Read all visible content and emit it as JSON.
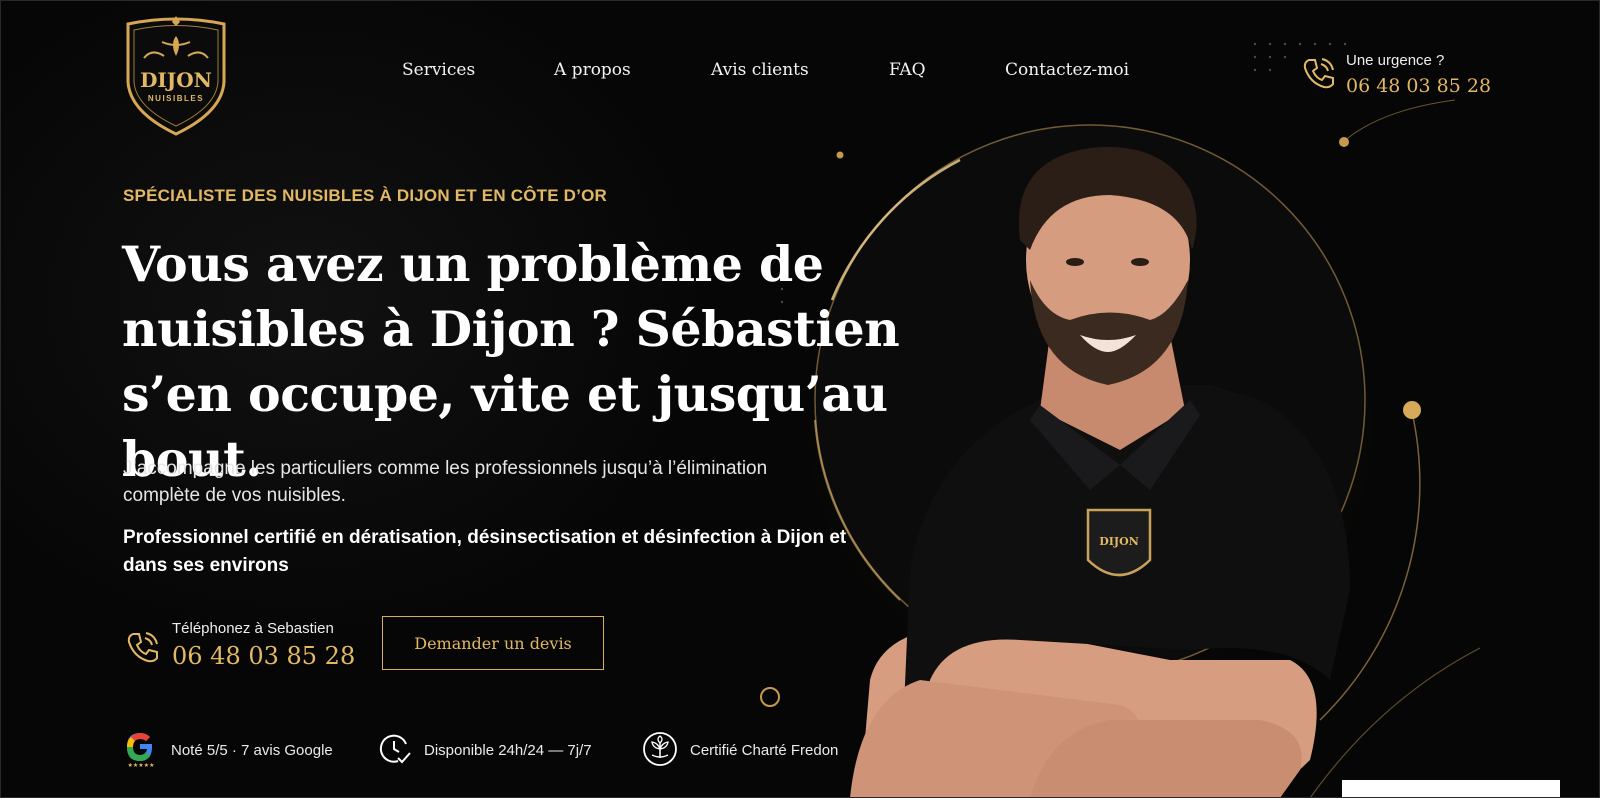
{
  "brand": {
    "name": "DIJON",
    "tagline": "NUISIBLES"
  },
  "nav": {
    "items": [
      {
        "label": "Services"
      },
      {
        "label": "A propos"
      },
      {
        "label": "Avis clients"
      },
      {
        "label": "FAQ"
      },
      {
        "label": "Contactez-moi"
      }
    ]
  },
  "urgent": {
    "label": "Une urgence ?",
    "phone": "06 48 03 85 28"
  },
  "hero": {
    "kicker": "SPÉCIALISTE DES NUISIBLES À DIJON ET EN CÔTE D’OR",
    "headline": "Vous avez un problème de nuisibles à Dijon ? Sébastien s’en occupe, vite et jusqu’au bout.",
    "lead": "J’accompagne les particuliers comme les professionnels jusqu’à l’élimination complète de vos nuisibles.",
    "strong": "Professionnel certifié en dératisation, désinsectisation et désinfection à Dijon et dans ses environs"
  },
  "cta": {
    "call_label": "Téléphonez à Sebastien",
    "call_phone": "06 48 03 85 28",
    "quote_button": "Demander un devis"
  },
  "badges": [
    {
      "icon": "google-icon",
      "text": "Noté 5/5 · 7 avis Google"
    },
    {
      "icon": "clock-check-icon",
      "text": "Disponible 24h/24 — 7j/7"
    },
    {
      "icon": "leaf-certificate-icon",
      "text": "Certifié Charté Fredon"
    }
  ],
  "colors": {
    "accent": "#e2b864",
    "background": "#060606",
    "text": "#ffffff"
  }
}
